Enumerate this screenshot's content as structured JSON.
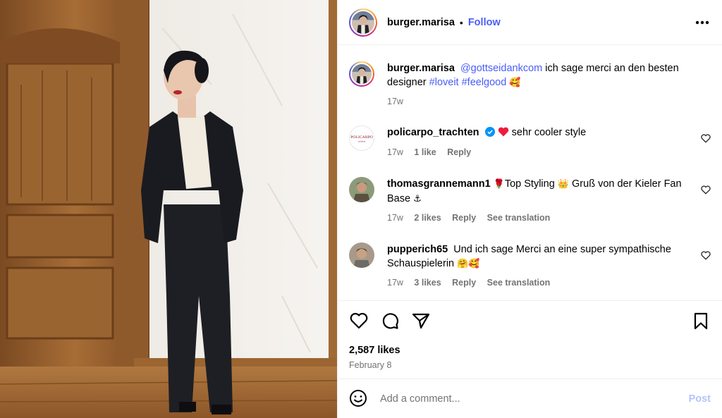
{
  "post": {
    "username": "burger.marisa",
    "separator": "•",
    "follow_label": "Follow",
    "more_icon": "more-horizontal-icon"
  },
  "caption": {
    "username": "burger.marisa",
    "mention": "@gottseidankcom",
    "text": "ich sage merci an den besten designer",
    "tags": [
      "#loveit",
      "#feelgood"
    ],
    "emoji": "🥰",
    "time": "17w"
  },
  "comments": [
    {
      "username": "policarpo_trachten",
      "verified": true,
      "emoji_prefix": "❤",
      "text": "sehr cooler style",
      "time": "17w",
      "likes": "1 like",
      "reply": "Reply",
      "translation": ""
    },
    {
      "username": "thomasgrannemann1",
      "text_parts": [
        "🌹",
        "Top Styling ",
        "👑",
        " Gruß von der Kieler Fan Base ",
        "⚓"
      ],
      "time": "17w",
      "likes": "2 likes",
      "reply": "Reply",
      "translation": "See translation"
    },
    {
      "username": "pupperich65",
      "text": "Und ich sage Merci an eine super sympathische Schauspielerin",
      "emoji": "🤗🥰",
      "time": "17w",
      "likes": "3 likes",
      "reply": "Reply",
      "translation": "See translation"
    }
  ],
  "actions": {
    "likes": "2,587 likes",
    "date": "February 8"
  },
  "add_comment": {
    "placeholder": "Add a comment...",
    "post_label": "Post"
  },
  "colors": {
    "link": "#4a5df9",
    "muted": "#737373",
    "post_disabled": "#b5c3fb",
    "heart_red": "#ed1c3c",
    "verified": "#0095f6"
  }
}
